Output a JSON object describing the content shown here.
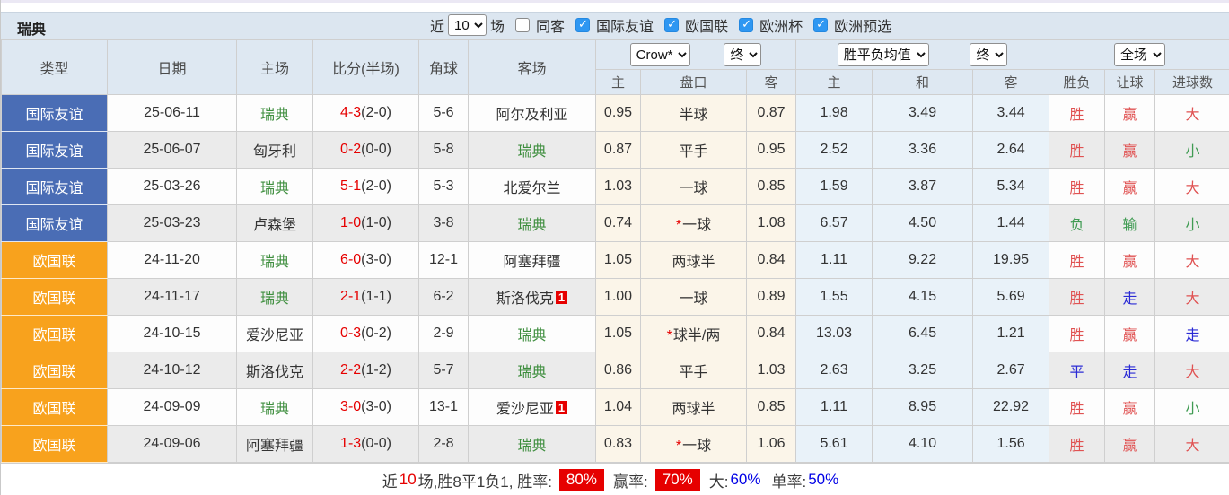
{
  "header": {
    "team": "瑞典",
    "recent_label": "近",
    "recent_count": "10",
    "matches_label": "场",
    "same_away_label": "同客",
    "same_away_checked": false,
    "filters": [
      {
        "label": "国际友谊",
        "checked": true
      },
      {
        "label": "欧国联",
        "checked": true
      },
      {
        "label": "欧洲杯",
        "checked": true
      },
      {
        "label": "欧洲预选",
        "checked": true
      }
    ]
  },
  "table": {
    "columns": [
      "类型",
      "日期",
      "主场",
      "比分(半场)",
      "角球",
      "客场"
    ],
    "selects": {
      "bookmaker": "Crow*",
      "handicap_time": "终",
      "avg_odds": "胜平负均值",
      "avg_time": "终",
      "scope": "全场"
    },
    "sub_columns": [
      "主",
      "盘口",
      "客",
      "主",
      "和",
      "客",
      "胜负",
      "让球",
      "进球数"
    ],
    "rows": [
      {
        "type": "国际友谊",
        "type_style": "blue",
        "date": "25-06-11",
        "home": "瑞典",
        "home_green": true,
        "score": "4-3",
        "half": "(2-0)",
        "corner": "5-6",
        "away": "阿尔及利亚",
        "away_green": false,
        "away_badge": "",
        "ah_home": "0.95",
        "handicap": "半球",
        "ah_away": "0.87",
        "odds_home": "1.98",
        "odds_draw": "3.49",
        "odds_away": "3.44",
        "result": "胜",
        "result_color": "red",
        "handicap_result": "赢",
        "hr_color": "red",
        "goals": "大",
        "goals_color": "red"
      },
      {
        "type": "国际友谊",
        "type_style": "blue",
        "date": "25-06-07",
        "home": "匈牙利",
        "home_green": false,
        "score": "0-2",
        "half": "(0-0)",
        "corner": "5-8",
        "away": "瑞典",
        "away_green": true,
        "away_badge": "",
        "ah_home": "0.87",
        "handicap": "平手",
        "ah_away": "0.95",
        "odds_home": "2.52",
        "odds_draw": "3.36",
        "odds_away": "2.64",
        "result": "胜",
        "result_color": "red",
        "handicap_result": "赢",
        "hr_color": "red",
        "goals": "小",
        "goals_color": "green"
      },
      {
        "type": "国际友谊",
        "type_style": "blue",
        "date": "25-03-26",
        "home": "瑞典",
        "home_green": true,
        "score": "5-1",
        "half": "(2-0)",
        "corner": "5-3",
        "away": "北爱尔兰",
        "away_green": false,
        "away_badge": "",
        "ah_home": "1.03",
        "handicap": "一球",
        "ah_away": "0.85",
        "odds_home": "1.59",
        "odds_draw": "3.87",
        "odds_away": "5.34",
        "result": "胜",
        "result_color": "red",
        "handicap_result": "赢",
        "hr_color": "red",
        "goals": "大",
        "goals_color": "red"
      },
      {
        "type": "国际友谊",
        "type_style": "blue",
        "date": "25-03-23",
        "home": "卢森堡",
        "home_green": false,
        "score": "1-0",
        "half": "(1-0)",
        "corner": "3-8",
        "away": "瑞典",
        "away_green": true,
        "away_badge": "",
        "ah_home": "0.74",
        "handicap": "*一球",
        "ah_away": "1.08",
        "odds_home": "6.57",
        "odds_draw": "4.50",
        "odds_away": "1.44",
        "result": "负",
        "result_color": "green",
        "handicap_result": "输",
        "hr_color": "green",
        "goals": "小",
        "goals_color": "green"
      },
      {
        "type": "欧国联",
        "type_style": "orange",
        "date": "24-11-20",
        "home": "瑞典",
        "home_green": true,
        "score": "6-0",
        "half": "(3-0)",
        "corner": "12-1",
        "away": "阿塞拜疆",
        "away_green": false,
        "away_badge": "",
        "ah_home": "1.05",
        "handicap": "两球半",
        "ah_away": "0.84",
        "odds_home": "1.11",
        "odds_draw": "9.22",
        "odds_away": "19.95",
        "result": "胜",
        "result_color": "red",
        "handicap_result": "赢",
        "hr_color": "red",
        "goals": "大",
        "goals_color": "red"
      },
      {
        "type": "欧国联",
        "type_style": "orange",
        "date": "24-11-17",
        "home": "瑞典",
        "home_green": true,
        "score": "2-1",
        "half": "(1-1)",
        "corner": "6-2",
        "away": "斯洛伐克",
        "away_green": false,
        "away_badge": "1",
        "ah_home": "1.00",
        "handicap": "一球",
        "ah_away": "0.89",
        "odds_home": "1.55",
        "odds_draw": "4.15",
        "odds_away": "5.69",
        "result": "胜",
        "result_color": "red",
        "handicap_result": "走",
        "hr_color": "blue",
        "goals": "大",
        "goals_color": "red"
      },
      {
        "type": "欧国联",
        "type_style": "orange",
        "date": "24-10-15",
        "home": "爱沙尼亚",
        "home_green": false,
        "score": "0-3",
        "half": "(0-2)",
        "corner": "2-9",
        "away": "瑞典",
        "away_green": true,
        "away_badge": "",
        "ah_home": "1.05",
        "handicap": "*球半/两",
        "ah_away": "0.84",
        "odds_home": "13.03",
        "odds_draw": "6.45",
        "odds_away": "1.21",
        "result": "胜",
        "result_color": "red",
        "handicap_result": "赢",
        "hr_color": "red",
        "goals": "走",
        "goals_color": "blue"
      },
      {
        "type": "欧国联",
        "type_style": "orange",
        "date": "24-10-12",
        "home": "斯洛伐克",
        "home_green": false,
        "score": "2-2",
        "half": "(1-2)",
        "corner": "5-7",
        "away": "瑞典",
        "away_green": true,
        "away_badge": "",
        "ah_home": "0.86",
        "handicap": "平手",
        "ah_away": "1.03",
        "odds_home": "2.63",
        "odds_draw": "3.25",
        "odds_away": "2.67",
        "result": "平",
        "result_color": "blue",
        "handicap_result": "走",
        "hr_color": "blue",
        "goals": "大",
        "goals_color": "red"
      },
      {
        "type": "欧国联",
        "type_style": "orange",
        "date": "24-09-09",
        "home": "瑞典",
        "home_green": true,
        "score": "3-0",
        "half": "(3-0)",
        "corner": "13-1",
        "away": "爱沙尼亚",
        "away_green": false,
        "away_badge": "1",
        "ah_home": "1.04",
        "handicap": "两球半",
        "ah_away": "0.85",
        "odds_home": "1.11",
        "odds_draw": "8.95",
        "odds_away": "22.92",
        "result": "胜",
        "result_color": "red",
        "handicap_result": "赢",
        "hr_color": "red",
        "goals": "小",
        "goals_color": "green"
      },
      {
        "type": "欧国联",
        "type_style": "orange",
        "date": "24-09-06",
        "home": "阿塞拜疆",
        "home_green": false,
        "score": "1-3",
        "half": "(0-0)",
        "corner": "2-8",
        "away": "瑞典",
        "away_green": true,
        "away_badge": "",
        "ah_home": "0.83",
        "handicap": "*一球",
        "ah_away": "1.06",
        "odds_home": "5.61",
        "odds_draw": "4.10",
        "odds_away": "1.56",
        "result": "胜",
        "result_color": "red",
        "handicap_result": "赢",
        "hr_color": "red",
        "goals": "大",
        "goals_color": "red"
      }
    ]
  },
  "footer": {
    "prefix": "近",
    "count": "10",
    "summary": "场,胜8平1负1, 胜率:",
    "win_rate": "80%",
    "handicap_label": "赢率:",
    "handicap_rate": "70%",
    "big_label": "大:",
    "big_rate": "60%",
    "single_label": "单率:",
    "single_rate": "50%"
  },
  "colors": {
    "friendly_blue": "#4a6db5",
    "league_orange": "#f8a21d",
    "team_green": "#3e8e3e",
    "score_red": "#e60000",
    "result_red": "#e05252",
    "result_green": "#3f9b52",
    "result_blue": "#2b2bd5",
    "rate_badge_red": "#e60000",
    "rate_blue": "#0000e6",
    "checkbox_blue": "#2e97f2"
  }
}
